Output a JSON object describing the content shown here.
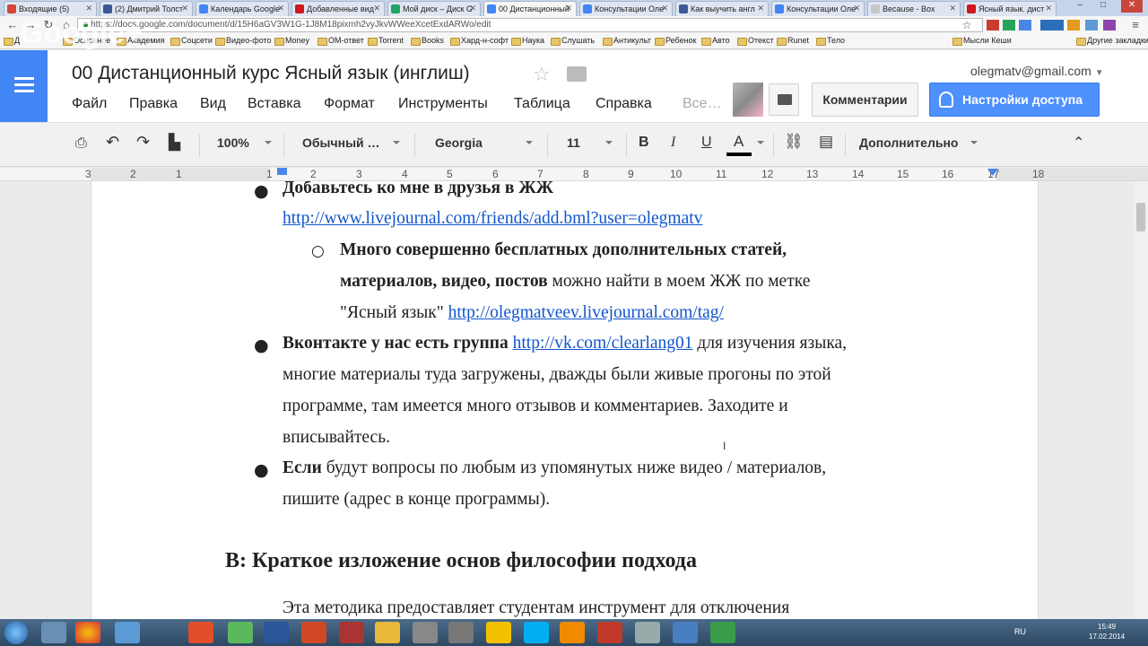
{
  "browser": {
    "tabs": [
      {
        "label": "Входящие (5)",
        "color": "#d44638"
      },
      {
        "label": "(2) Дмитрий Толст",
        "color": "#3b5998"
      },
      {
        "label": "Календарь Google",
        "color": "#4285f4"
      },
      {
        "label": "Добавленные вид",
        "color": "#cc181e"
      },
      {
        "label": "Мой диск – Диск G",
        "color": "#1fa463"
      },
      {
        "label": "00 Дистанционный",
        "color": "#4285f4",
        "active": true
      },
      {
        "label": "Консультации Оле",
        "color": "#4285f4"
      },
      {
        "label": "Как выучить англ",
        "color": "#3b5998"
      },
      {
        "label": "Консультации Оле",
        "color": "#4285f4"
      },
      {
        "label": "Because - Box",
        "color": "#c7c7c7"
      },
      {
        "label": "Ясный язык. дист",
        "color": "#cc181e"
      }
    ],
    "url": "https://docs.google.com/document/d/15H6aGV3W1G-1J8M18pixmh2vyJkvWWeeXcetExdARWo/edit",
    "bookmarks": [
      "Д",
      "Основное",
      "Академия",
      "Соцсети",
      "Видео-фото",
      "Money",
      "ОМ-ответ",
      "Torrent",
      "Books",
      "Хард-н-софт",
      "Наука",
      "Слушать",
      "Антикульт",
      "Ребенок",
      "Авто",
      "Отекст",
      "Runet",
      "Тело",
      "Мысли Кеши",
      "Другие закладки"
    ]
  },
  "watermark": "Google+",
  "docs": {
    "title": "00 Дистанционный курс Ясный язык (инглиш)",
    "menu": [
      "Файл",
      "Правка",
      "Вид",
      "Вставка",
      "Формат",
      "Инструменты",
      "Таблица",
      "Справка",
      "Все…"
    ],
    "account": "olegmatv@gmail.com",
    "comments_label": "Комментарии",
    "share_label": "Настройки доступа"
  },
  "toolbar": {
    "zoom": "100%",
    "style": "Обычный …",
    "font": "Georgia",
    "size": "11",
    "more": "Дополнительно"
  },
  "ruler": [
    "3",
    "2",
    "1",
    "1",
    "2",
    "3",
    "4",
    "5",
    "6",
    "7",
    "8",
    "9",
    "10",
    "11",
    "12",
    "13",
    "14",
    "15",
    "16",
    "17",
    "18"
  ],
  "content": {
    "l1_bold": "Добавьтесь ко мне в друзья в ЖЖ",
    "l1_link": "http://www.livejournal.com/friends/add.bml?user=olegmatv",
    "sub_bold_1": "Много совершенно бесплатных дополнительных статей,",
    "sub_bold_2": "материалов, видео, постов",
    "sub_rest_2": " можно найти в моем ЖЖ по метке",
    "sub_3_text": "\"Ясный язык\" ",
    "sub_3_link": "http://olegmatveev.livejournal.com/tag/",
    "vk_bold": "Вконтакте у нас есть группа",
    "vk_link": "http://vk.com/clearlang01",
    "vk_rest": " для изучения языка,",
    "vk_line2": "многие материалы туда загружены, дважды были живые прогоны по этой",
    "vk_line3": "программе, там имеется много отзывов и комментариев. Заходите и",
    "vk_line4": "вписывайтесь.",
    "q_bold": "Если",
    "q_rest": " будут вопросы по любым из упомянутых ниже видео / материалов,",
    "q_line2": "пишите (адрес в конце программы).",
    "heading": "B: Краткое изложение основ философии подхода",
    "para": "Эта методика предоставляет студентам инструмент для отключения"
  },
  "taskbar": {
    "lang": "RU",
    "time": "15:49",
    "date": "17.02.2014"
  }
}
